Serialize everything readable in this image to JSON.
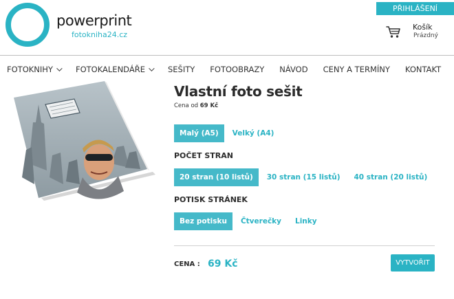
{
  "header": {
    "brand": "powerprint",
    "brand_sub": "fotokniha24.cz",
    "login_label": "PŘIHLÁŠENÍ",
    "cart_title": "Košík",
    "cart_status": "Prázdný",
    "accent_color": "#2ab3c4"
  },
  "nav": {
    "items": [
      {
        "label": "FOTOKNIHY",
        "has_dropdown": true
      },
      {
        "label": "FOTOKALENDÁŘE",
        "has_dropdown": true
      },
      {
        "label": "SEŠITY",
        "has_dropdown": false
      },
      {
        "label": "FOTOOBRAZY",
        "has_dropdown": false
      },
      {
        "label": "NÁVOD",
        "has_dropdown": false
      },
      {
        "label": "CENY A TERMÍNY",
        "has_dropdown": false
      },
      {
        "label": "KONTAKT",
        "has_dropdown": false
      }
    ]
  },
  "product": {
    "title": "Vlastní foto sešit",
    "price_from_label": "Cena od",
    "price_from_value": "69 Kč",
    "sizes": [
      {
        "label": "Malý (A5)",
        "active": true
      },
      {
        "label": "Velký (A4)",
        "active": false
      }
    ],
    "pages_label": "POČET STRAN",
    "pages": [
      {
        "label": "20 stran (10 listů)",
        "active": true
      },
      {
        "label": "30 stran (15 listů)",
        "active": false
      },
      {
        "label": "40 stran (20 listů)",
        "active": false
      }
    ],
    "print_label": "POTISK STRÁNEK",
    "print_options": [
      {
        "label": "Bez potisku",
        "active": true
      },
      {
        "label": "Čtverečky",
        "active": false
      },
      {
        "label": "Linky",
        "active": false
      }
    ],
    "price_label": "CENA :",
    "price_value": "69 Kč",
    "create_label": "VYTVOŘIT"
  }
}
